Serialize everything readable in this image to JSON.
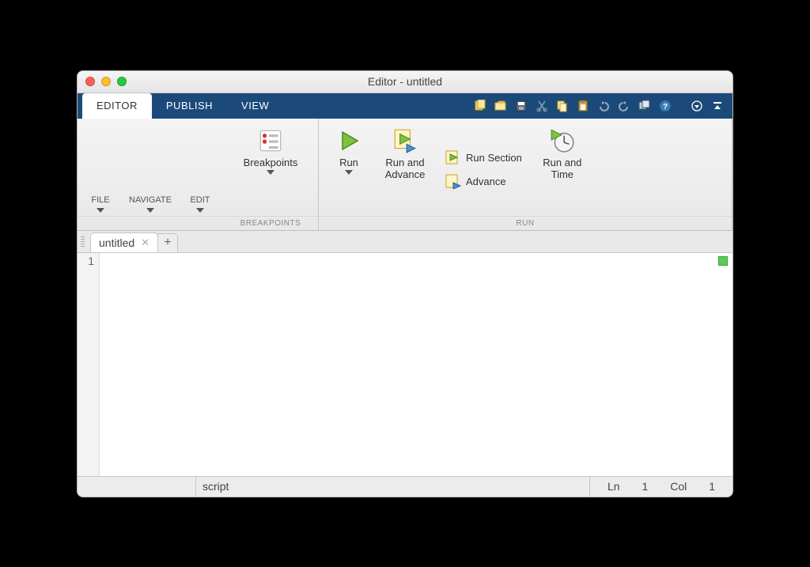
{
  "window": {
    "title": "Editor - untitled"
  },
  "tabs": {
    "editor": "EDITOR",
    "publish": "PUBLISH",
    "view": "VIEW"
  },
  "ribbon": {
    "file": "FILE",
    "navigate": "NAVIGATE",
    "edit": "EDIT",
    "breakpoints": "Breakpoints",
    "breakpoints_group": "BREAKPOINTS",
    "run": "Run",
    "run_and_advance": "Run and Advance",
    "run_section": "Run Section",
    "advance": "Advance",
    "run_and_time": "Run and Time",
    "run_group": "RUN"
  },
  "filetab": {
    "name": "untitled"
  },
  "gutter": {
    "line1": "1"
  },
  "status": {
    "type": "script",
    "ln_label": "Ln",
    "ln": "1",
    "col_label": "Col",
    "col": "1"
  }
}
